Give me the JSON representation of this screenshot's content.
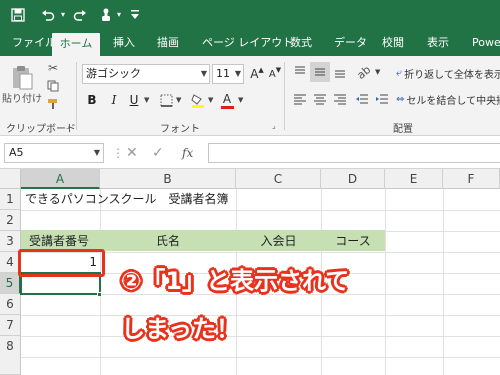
{
  "colors": {
    "accent": "#217346",
    "header_fill": "#c6e0b4",
    "callout": "#e8321c"
  },
  "quick_access": {
    "save_icon": "save-icon",
    "undo_icon": "undo-icon",
    "redo_icon": "redo-icon",
    "touch_icon": "touch-mode-icon",
    "customize_icon": "customize-icon"
  },
  "tabs": [
    {
      "label": "ファイル"
    },
    {
      "label": "ホーム"
    },
    {
      "label": "挿入"
    },
    {
      "label": "描画"
    },
    {
      "label": "ページ レイアウト"
    },
    {
      "label": "数式"
    },
    {
      "label": "データ"
    },
    {
      "label": "校閲"
    },
    {
      "label": "表示"
    },
    {
      "label": "Power"
    }
  ],
  "ribbon": {
    "clipboard": {
      "paste_label": "貼り付け",
      "group_label": "クリップボード"
    },
    "font": {
      "font_name": "游ゴシック",
      "font_size": "11",
      "grow_label": "A",
      "shrink_label": "A",
      "bold": "B",
      "italic": "I",
      "underline": "U",
      "font_color_label": "A",
      "group_label": "フォント"
    },
    "alignment": {
      "wrap_text": "折り返して全体を表示",
      "merge_center": "セルを結合して中央揃",
      "group_label": "配置"
    }
  },
  "formula_bar": {
    "name_box": "A5",
    "fx_label": "fx",
    "formula": ""
  },
  "columns": [
    "A",
    "B",
    "C",
    "D",
    "E",
    "F"
  ],
  "rows": [
    "1",
    "2",
    "3",
    "4",
    "5",
    "6",
    "7",
    "8"
  ],
  "selected_cell": "A5",
  "cells": {
    "a1": "できるパソコンスクール　受講者名簿",
    "a3": "受講者番号",
    "b3": "氏名",
    "c3": "入会日",
    "d3": "コース",
    "a4": "1"
  },
  "callout": {
    "line1": "②「1」と表示されて",
    "line2": "しまった！"
  }
}
